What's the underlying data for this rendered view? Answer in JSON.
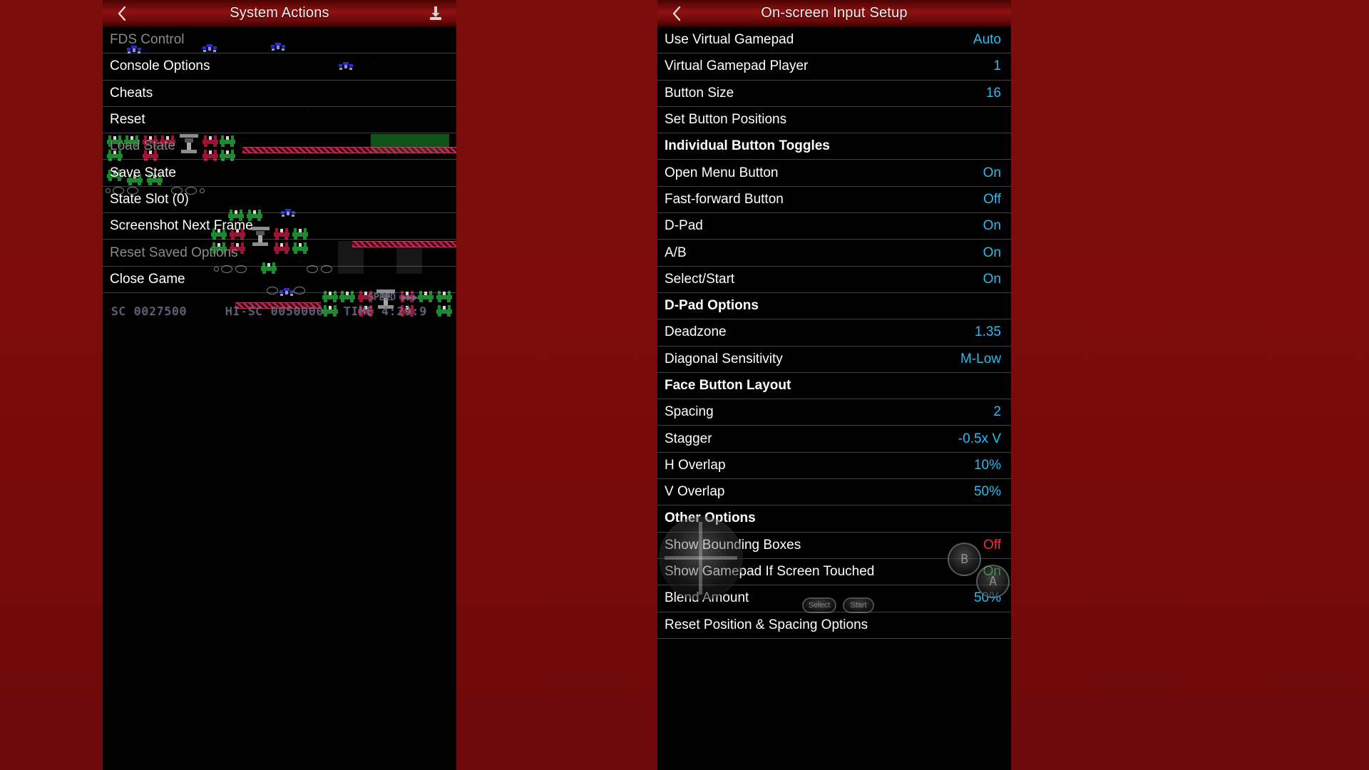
{
  "theme": {
    "background": "#7d0b0b",
    "header_red": "#8e1212",
    "panel_bg": "#000000",
    "value_blue": "#2fbbf0",
    "value_green": "#2fdb3a",
    "value_red": "#f2303a",
    "label_white": "#ffffff",
    "label_dim": "#8a8a8a"
  },
  "left_panel": {
    "title": "System Actions",
    "back_icon": "chevron-left-icon",
    "action_icon": "save-state-download-icon",
    "items": [
      {
        "label": "FDS Control",
        "value": "",
        "dim": true,
        "heading": false
      },
      {
        "label": "Console Options",
        "value": "",
        "dim": false,
        "heading": false
      },
      {
        "label": "Cheats",
        "value": "",
        "dim": false,
        "heading": false
      },
      {
        "label": "Reset",
        "value": "",
        "dim": false,
        "heading": false
      },
      {
        "label": "Load State",
        "value": "",
        "dim": true,
        "heading": false
      },
      {
        "label": "Save State",
        "value": "",
        "dim": false,
        "heading": false
      },
      {
        "label": "State Slot (0)",
        "value": "",
        "dim": false,
        "heading": false
      },
      {
        "label": "Screenshot Next Frame",
        "value": "",
        "dim": false,
        "heading": false
      },
      {
        "label": "Reset Saved Options",
        "value": "",
        "dim": true,
        "heading": false
      },
      {
        "label": "Close Game",
        "value": "",
        "dim": false,
        "heading": false
      }
    ],
    "game_hud": {
      "score_label": "SC",
      "score_value": "0027500",
      "hiscore_label": "HI-SC",
      "hiscore_value": "0050000",
      "time_label": "TIME",
      "time_value": "4:29:9",
      "speed_label": "SPEED",
      "speed_arrows": "▶▶▶"
    }
  },
  "right_panel": {
    "title": "On-screen Input Setup",
    "back_icon": "chevron-left-icon",
    "items": [
      {
        "label": "Use Virtual Gamepad",
        "value": "Auto",
        "heading": false,
        "value_color": "blue"
      },
      {
        "label": "Virtual Gamepad Player",
        "value": "1",
        "heading": false,
        "value_color": "blue"
      },
      {
        "label": "Button Size",
        "value": "16",
        "heading": false,
        "value_color": "blue"
      },
      {
        "label": "Set Button Positions",
        "value": "",
        "heading": false,
        "value_color": "blue"
      },
      {
        "label": "Individual Button Toggles",
        "value": "",
        "heading": true,
        "value_color": "blue"
      },
      {
        "label": "Open Menu Button",
        "value": "On",
        "heading": false,
        "value_color": "blue"
      },
      {
        "label": "Fast-forward Button",
        "value": "Off",
        "heading": false,
        "value_color": "blue"
      },
      {
        "label": "D-Pad",
        "value": "On",
        "heading": false,
        "value_color": "blue"
      },
      {
        "label": "A/B",
        "value": "On",
        "heading": false,
        "value_color": "blue"
      },
      {
        "label": "Select/Start",
        "value": "On",
        "heading": false,
        "value_color": "blue"
      },
      {
        "label": "D-Pad Options",
        "value": "",
        "heading": true,
        "value_color": "blue"
      },
      {
        "label": "Deadzone",
        "value": "1.35",
        "heading": false,
        "value_color": "blue"
      },
      {
        "label": "Diagonal Sensitivity",
        "value": "M-Low",
        "heading": false,
        "value_color": "blue"
      },
      {
        "label": "Face Button Layout",
        "value": "",
        "heading": true,
        "value_color": "blue"
      },
      {
        "label": "Spacing",
        "value": "2",
        "heading": false,
        "value_color": "blue"
      },
      {
        "label": "Stagger",
        "value": "-0.5x V",
        "heading": false,
        "value_color": "blue"
      },
      {
        "label": "H Overlap",
        "value": "10%",
        "heading": false,
        "value_color": "blue"
      },
      {
        "label": "V Overlap",
        "value": "50%",
        "heading": false,
        "value_color": "blue"
      },
      {
        "label": "Other Options",
        "value": "",
        "heading": true,
        "value_color": "blue"
      },
      {
        "label": "Show Bounding Boxes",
        "value": "Off",
        "heading": false,
        "value_color": "red"
      },
      {
        "label": "Show Gamepad If Screen Touched",
        "value": "On",
        "heading": false,
        "value_color": "green"
      },
      {
        "label": "Blend Amount",
        "value": "50%",
        "heading": false,
        "value_color": "blue"
      },
      {
        "label": "Reset Position & Spacing Options",
        "value": "",
        "heading": false,
        "value_color": "blue"
      }
    ],
    "gamepad_overlay": {
      "dpad_name": "virtual-dpad",
      "b_button": "B",
      "a_button": "A",
      "select_button": "Select",
      "start_button": "Start"
    }
  }
}
